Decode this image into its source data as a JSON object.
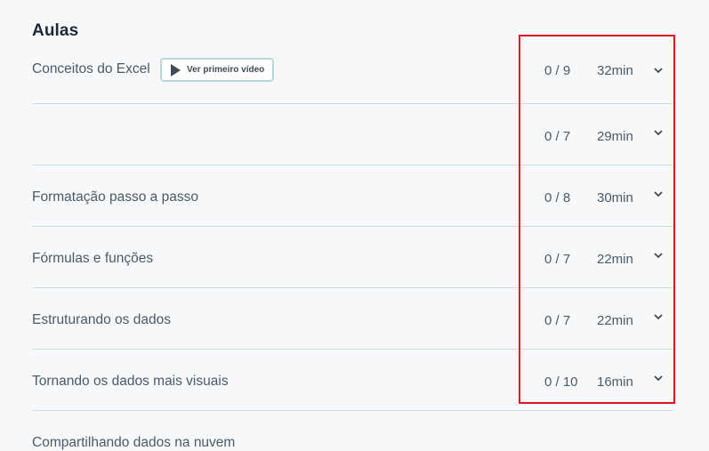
{
  "section": {
    "title": "Aulas"
  },
  "first_video_button": {
    "label": "Ver primeiro vídeo",
    "icon": "play-icon"
  },
  "lessons": [
    {
      "title": "Conceitos do Excel",
      "progress": "0 / 9",
      "duration": "32min"
    },
    {
      "title": "Formatação passo a passo",
      "progress": "0 / 7",
      "duration": "29min"
    },
    {
      "title": "Fórmulas e funções",
      "progress": "0 / 8",
      "duration": "30min"
    },
    {
      "title": "Estruturando os dados",
      "progress": "0 / 7",
      "duration": "22min"
    },
    {
      "title": "Tornando os dados mais visuais",
      "progress": "0 / 7",
      "duration": "22min"
    },
    {
      "title": "Compartilhando dados na nuvem",
      "progress": "0 / 10",
      "duration": "16min"
    }
  ],
  "colors": {
    "background": "#f6f8fa",
    "text": "#4b5b66",
    "divider": "#c9dde3",
    "highlight": "#e3111b"
  }
}
